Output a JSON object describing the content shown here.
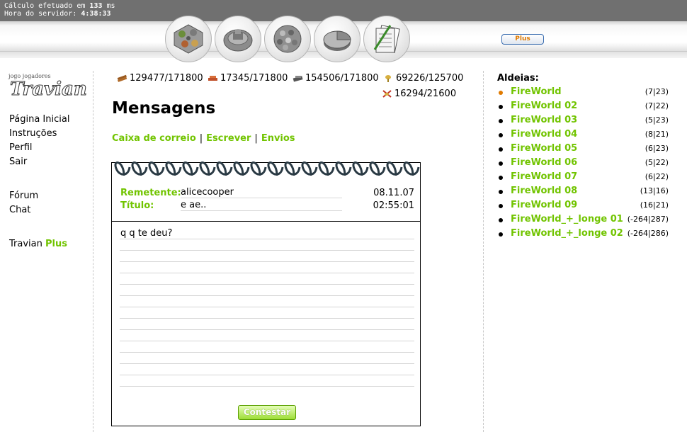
{
  "status": {
    "calc_prefix": "Cálculo efetuado em",
    "calc_value": "133",
    "calc_unit": "ms",
    "server_label": "Hora do servidor:",
    "server_time": "4:38:33"
  },
  "nav_icons": [
    "village-overview-icon",
    "village-center-icon",
    "map-icon",
    "statistics-icon",
    "reports-messages-icon"
  ],
  "plus_button": "Plus",
  "logo_text": "Travian",
  "sidebar": {
    "items": [
      "Página Inicial",
      "Instruções",
      "Perfil",
      "Sair"
    ],
    "items2": [
      "Fórum",
      "Chat"
    ],
    "plus_prefix": "Travian",
    "plus_suffix": "Plus"
  },
  "resources": {
    "wood": "129477/171800",
    "clay": "17345/171800",
    "iron": "154506/171800",
    "crop": "69226/125700",
    "consumption": "16294/21600"
  },
  "page_title": "Mensagens",
  "subnav": {
    "inbox": "Caixa de correio",
    "write": "Escrever",
    "sent": "Envios",
    "separator": "|"
  },
  "message": {
    "sender_label": "Remetente:",
    "sender": "alicecooper",
    "subject_label": "Título:",
    "subject": "e ae..",
    "date": "08.11.07",
    "time": "02:55:01",
    "body": "q q te deu?",
    "reply_button": "Contestar"
  },
  "villages": {
    "title": "Aldeias:",
    "list": [
      {
        "name": "FireWorld",
        "coords": "(7|23)",
        "active": true
      },
      {
        "name": "FireWorld 02",
        "coords": "(7|22)",
        "active": false
      },
      {
        "name": "FireWorld 03",
        "coords": "(5|23)",
        "active": false
      },
      {
        "name": "FireWorld 04",
        "coords": "(8|21)",
        "active": false
      },
      {
        "name": "FireWorld 05",
        "coords": "(6|23)",
        "active": false
      },
      {
        "name": "FireWorld 06",
        "coords": "(5|22)",
        "active": false
      },
      {
        "name": "FireWorld 07",
        "coords": "(6|22)",
        "active": false
      },
      {
        "name": "FireWorld 08",
        "coords": "(13|16)",
        "active": false
      },
      {
        "name": "FireWorld 09",
        "coords": "(16|21)",
        "active": false
      },
      {
        "name": "FireWorld_+_longe 01",
        "coords": "(-264|287)",
        "active": false
      },
      {
        "name": "FireWorld_+_longe 02",
        "coords": "(-264|286)",
        "active": false
      }
    ]
  }
}
